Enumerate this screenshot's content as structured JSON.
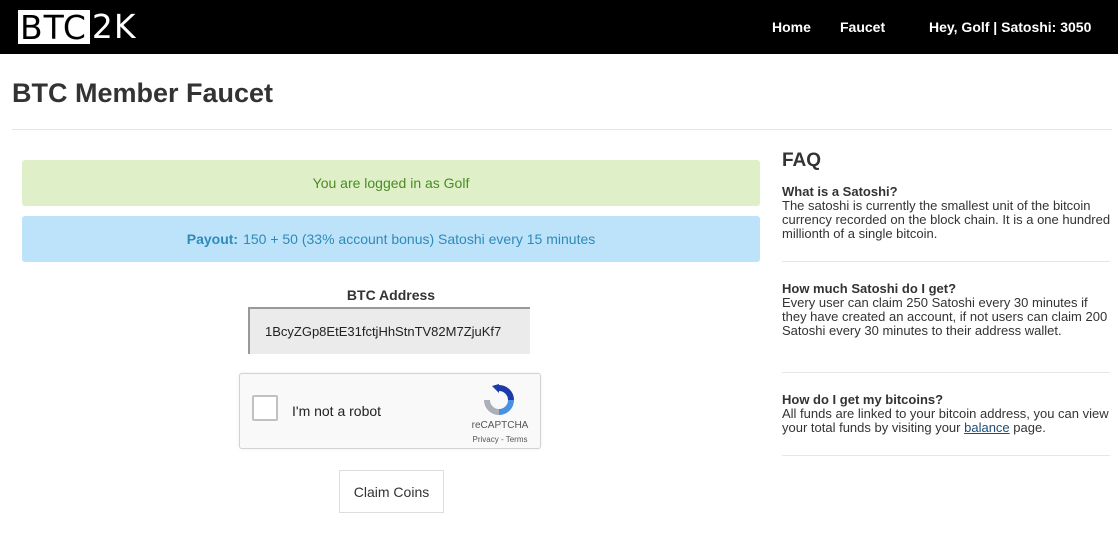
{
  "nav": {
    "logo_boxed": "BTC",
    "logo_rest": "2K",
    "home": "Home",
    "faucet": "Faucet",
    "user_label": "Hey, Golf | Satoshi: 3050"
  },
  "page": {
    "title": "BTC Member Faucet"
  },
  "alerts": {
    "logged_in": "You are logged in as Golf",
    "payout_label": "Payout:",
    "payout_text": "150 + 50 (33% account bonus) Satoshi every 15 minutes"
  },
  "form": {
    "address_label": "BTC Address",
    "address_value": "1BcyZGp8EtE31fctjHhStnTV82M7ZjuKf7",
    "captcha_label": "I'm not a robot",
    "captcha_brand": "reCAPTCHA",
    "captcha_links": "Privacy - Terms",
    "claim_label": "Claim Coins"
  },
  "faq": {
    "title": "FAQ",
    "items": [
      {
        "q": "What is a Satoshi?",
        "a": "The satoshi is currently the smallest unit of the bitcoin currency recorded on the block chain. It is a one hundred millionth of a single bitcoin."
      },
      {
        "q": "How much Satoshi do I get?",
        "a": "Every user can claim 250 Satoshi every 30 minutes if they have created an account, if not users can claim 200 Satoshi every 30 minutes to their address wallet."
      },
      {
        "q": "How do I get my bitcoins?",
        "a_before": "All funds are linked to your bitcoin address, you can view your total funds by visiting your",
        "link": "balance",
        "a_after": "page."
      }
    ]
  },
  "colors": {
    "nav_bg": "#000000",
    "success_bg": "#dff0c8",
    "success_text": "#4c8a25",
    "info_bg": "#bde3fb",
    "info_text": "#2f8ab8"
  }
}
